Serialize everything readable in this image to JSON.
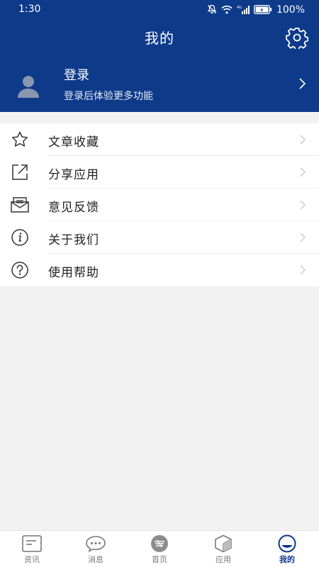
{
  "status_bar": {
    "time": "1:30",
    "battery": "100%",
    "network": "4G"
  },
  "header": {
    "title": "我的",
    "settings_icon": "gear-icon"
  },
  "profile": {
    "title": "登录",
    "subtitle": "登录后体验更多功能"
  },
  "menu": [
    {
      "label": "文章收藏",
      "icon": "star-icon"
    },
    {
      "label": "分享应用",
      "icon": "share-icon"
    },
    {
      "label": "意见反馈",
      "icon": "mail-icon"
    },
    {
      "label": "关于我们",
      "icon": "info-icon"
    },
    {
      "label": "使用帮助",
      "icon": "help-icon"
    }
  ],
  "tabbar": {
    "active": "我的",
    "tabs": [
      {
        "label": "资讯",
        "icon": "news-icon"
      },
      {
        "label": "消息",
        "icon": "message-icon"
      },
      {
        "label": "首页",
        "icon": "home-icon"
      },
      {
        "label": "应用",
        "icon": "apps-icon"
      },
      {
        "label": "我的",
        "icon": "profile-icon"
      }
    ]
  },
  "colors": {
    "brand": "#0e3a8a",
    "background": "#f2f2f2",
    "text": "#222222"
  }
}
